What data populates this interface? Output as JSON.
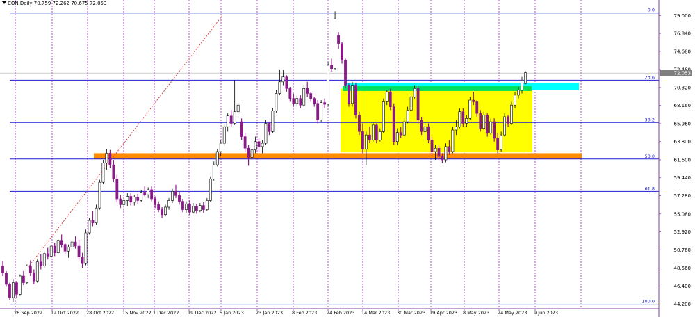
{
  "header": {
    "symbol_line": "CON,Daily  70.759 72.262 70.675 72.053"
  },
  "colors": {
    "bull": "#ffffff",
    "bear": "#8b1a89",
    "fib_line": "#1f1fd6",
    "orange_zone": "#ff8c00",
    "yellow_zone": "#ffff00",
    "cyan_zone": "#00ffff",
    "green_zone": "#00e060",
    "vgrid": "#a020c0",
    "trend": "#e03030",
    "axis": "#7b3fa0"
  },
  "chart_data": {
    "type": "candlestick",
    "title": "",
    "symbol": "CON",
    "timeframe": "Daily",
    "last_price": "72.053",
    "ylim": [
      44.0,
      80.2
    ],
    "y_ticks": [
      "79.000",
      "76.840",
      "74.680",
      "72.480",
      "70.320",
      "68.160",
      "65.960",
      "63.800",
      "61.600",
      "59.440",
      "57.280",
      "55.080",
      "52.920",
      "50.760",
      "48.560",
      "46.400",
      "44.200"
    ],
    "x_labels": [
      "26 Sep 2022",
      "12 Oct 2022",
      "28 Oct 2022",
      "15 Nov 2022",
      "1 Dec 2022",
      "19 Dec 2022",
      "5 Jan 2023",
      "23 Jan 2023",
      "8 Feb 2023",
      "24 Feb 2023",
      "14 Mar 2023",
      "30 Mar 2023",
      "19 Apr 2023",
      "8 May 2023",
      "24 May 2023",
      "9 Jun 2023"
    ],
    "fib_levels": [
      {
        "label": "0.0",
        "price": 79.3
      },
      {
        "label": "23.6",
        "price": 71.2
      },
      {
        "label": "38.2",
        "price": 66.1
      },
      {
        "label": "50.0",
        "price": 61.7
      },
      {
        "label": "61.8",
        "price": 57.8
      },
      {
        "label": "100.0",
        "price": 44.2
      }
    ],
    "candles": [
      {
        "o": 48.8,
        "h": 49.4,
        "l": 47.6,
        "c": 48.0
      },
      {
        "o": 48.0,
        "h": 48.2,
        "l": 46.3,
        "c": 46.6
      },
      {
        "o": 46.6,
        "h": 46.8,
        "l": 44.7,
        "c": 45.0
      },
      {
        "o": 45.0,
        "h": 47.2,
        "l": 44.5,
        "c": 46.8
      },
      {
        "o": 46.8,
        "h": 47.0,
        "l": 45.0,
        "c": 45.4
      },
      {
        "o": 45.4,
        "h": 47.8,
        "l": 45.2,
        "c": 47.6
      },
      {
        "o": 47.6,
        "h": 48.2,
        "l": 46.5,
        "c": 46.8
      },
      {
        "o": 46.8,
        "h": 49.0,
        "l": 46.6,
        "c": 48.8
      },
      {
        "o": 48.8,
        "h": 49.5,
        "l": 47.6,
        "c": 48.0
      },
      {
        "o": 48.0,
        "h": 48.4,
        "l": 46.6,
        "c": 47.0
      },
      {
        "o": 47.0,
        "h": 49.6,
        "l": 46.8,
        "c": 49.3
      },
      {
        "o": 49.3,
        "h": 50.2,
        "l": 48.4,
        "c": 48.8
      },
      {
        "o": 48.8,
        "h": 50.6,
        "l": 48.6,
        "c": 50.3
      },
      {
        "o": 50.3,
        "h": 51.0,
        "l": 49.6,
        "c": 50.0
      },
      {
        "o": 50.0,
        "h": 51.4,
        "l": 49.8,
        "c": 51.2
      },
      {
        "o": 51.2,
        "h": 51.6,
        "l": 50.0,
        "c": 50.4
      },
      {
        "o": 50.4,
        "h": 52.2,
        "l": 50.2,
        "c": 51.9
      },
      {
        "o": 51.9,
        "h": 52.6,
        "l": 51.0,
        "c": 51.4
      },
      {
        "o": 51.4,
        "h": 51.6,
        "l": 50.2,
        "c": 50.6
      },
      {
        "o": 50.6,
        "h": 51.4,
        "l": 49.8,
        "c": 51.1
      },
      {
        "o": 51.1,
        "h": 52.0,
        "l": 50.6,
        "c": 51.7
      },
      {
        "o": 51.7,
        "h": 52.4,
        "l": 50.9,
        "c": 51.2
      },
      {
        "o": 51.2,
        "h": 52.0,
        "l": 49.5,
        "c": 49.9
      },
      {
        "o": 49.9,
        "h": 50.4,
        "l": 48.6,
        "c": 49.1
      },
      {
        "o": 49.1,
        "h": 53.2,
        "l": 48.9,
        "c": 52.8
      },
      {
        "o": 52.8,
        "h": 54.6,
        "l": 52.6,
        "c": 54.3
      },
      {
        "o": 54.3,
        "h": 55.4,
        "l": 53.6,
        "c": 54.0
      },
      {
        "o": 54.0,
        "h": 56.2,
        "l": 53.8,
        "c": 55.8
      },
      {
        "o": 55.8,
        "h": 59.2,
        "l": 55.6,
        "c": 58.9
      },
      {
        "o": 58.9,
        "h": 61.6,
        "l": 58.7,
        "c": 61.2
      },
      {
        "o": 61.2,
        "h": 62.9,
        "l": 60.4,
        "c": 62.4
      },
      {
        "o": 62.4,
        "h": 62.8,
        "l": 60.6,
        "c": 61.0
      },
      {
        "o": 61.0,
        "h": 61.6,
        "l": 58.9,
        "c": 59.3
      },
      {
        "o": 59.3,
        "h": 59.8,
        "l": 56.5,
        "c": 56.9
      },
      {
        "o": 56.9,
        "h": 57.4,
        "l": 55.8,
        "c": 56.2
      },
      {
        "o": 56.2,
        "h": 57.0,
        "l": 55.4,
        "c": 56.7
      },
      {
        "o": 56.7,
        "h": 57.6,
        "l": 56.0,
        "c": 57.2
      },
      {
        "o": 57.2,
        "h": 57.6,
        "l": 56.1,
        "c": 56.5
      },
      {
        "o": 56.5,
        "h": 57.4,
        "l": 56.1,
        "c": 57.1
      },
      {
        "o": 57.1,
        "h": 57.5,
        "l": 56.3,
        "c": 56.7
      },
      {
        "o": 56.7,
        "h": 58.0,
        "l": 56.5,
        "c": 57.7
      },
      {
        "o": 57.7,
        "h": 58.4,
        "l": 57.2,
        "c": 57.4
      },
      {
        "o": 57.4,
        "h": 58.3,
        "l": 57.0,
        "c": 58.0
      },
      {
        "o": 58.0,
        "h": 58.4,
        "l": 56.6,
        "c": 56.9
      },
      {
        "o": 56.9,
        "h": 57.2,
        "l": 55.8,
        "c": 56.2
      },
      {
        "o": 56.2,
        "h": 56.6,
        "l": 55.3,
        "c": 55.6
      },
      {
        "o": 55.6,
        "h": 55.9,
        "l": 54.6,
        "c": 55.0
      },
      {
        "o": 55.0,
        "h": 56.2,
        "l": 54.8,
        "c": 55.9
      },
      {
        "o": 55.9,
        "h": 57.0,
        "l": 55.6,
        "c": 56.7
      },
      {
        "o": 56.7,
        "h": 58.1,
        "l": 56.4,
        "c": 57.8
      },
      {
        "o": 57.8,
        "h": 58.6,
        "l": 57.0,
        "c": 57.3
      },
      {
        "o": 57.3,
        "h": 57.8,
        "l": 56.2,
        "c": 56.6
      },
      {
        "o": 56.6,
        "h": 56.9,
        "l": 55.3,
        "c": 55.6
      },
      {
        "o": 55.6,
        "h": 56.6,
        "l": 55.2,
        "c": 56.3
      },
      {
        "o": 56.3,
        "h": 56.7,
        "l": 55.0,
        "c": 55.3
      },
      {
        "o": 55.3,
        "h": 56.4,
        "l": 55.1,
        "c": 56.0
      },
      {
        "o": 56.0,
        "h": 56.3,
        "l": 55.1,
        "c": 55.5
      },
      {
        "o": 55.5,
        "h": 56.4,
        "l": 55.3,
        "c": 56.1
      },
      {
        "o": 56.1,
        "h": 56.5,
        "l": 55.2,
        "c": 55.6
      },
      {
        "o": 55.6,
        "h": 57.0,
        "l": 55.4,
        "c": 56.7
      },
      {
        "o": 56.7,
        "h": 59.6,
        "l": 56.5,
        "c": 59.3
      },
      {
        "o": 59.3,
        "h": 61.4,
        "l": 59.1,
        "c": 61.0
      },
      {
        "o": 61.0,
        "h": 62.9,
        "l": 60.8,
        "c": 62.6
      },
      {
        "o": 62.6,
        "h": 64.0,
        "l": 62.0,
        "c": 63.6
      },
      {
        "o": 63.6,
        "h": 65.9,
        "l": 63.3,
        "c": 65.6
      },
      {
        "o": 65.6,
        "h": 67.2,
        "l": 65.0,
        "c": 66.9
      },
      {
        "o": 66.9,
        "h": 67.6,
        "l": 65.6,
        "c": 66.0
      },
      {
        "o": 66.0,
        "h": 71.2,
        "l": 65.8,
        "c": 67.4
      },
      {
        "o": 67.4,
        "h": 68.6,
        "l": 66.6,
        "c": 68.2
      },
      {
        "o": 66.2,
        "h": 66.6,
        "l": 64.0,
        "c": 64.4
      },
      {
        "o": 64.4,
        "h": 64.8,
        "l": 62.6,
        "c": 63.0
      },
      {
        "o": 63.0,
        "h": 63.4,
        "l": 60.9,
        "c": 61.9
      },
      {
        "o": 61.9,
        "h": 63.2,
        "l": 61.6,
        "c": 62.8
      },
      {
        "o": 62.8,
        "h": 64.4,
        "l": 62.4,
        "c": 63.8
      },
      {
        "o": 63.8,
        "h": 64.2,
        "l": 62.6,
        "c": 63.2
      },
      {
        "o": 63.2,
        "h": 64.0,
        "l": 62.4,
        "c": 63.6
      },
      {
        "o": 63.6,
        "h": 66.4,
        "l": 63.4,
        "c": 66.0
      },
      {
        "o": 66.0,
        "h": 66.2,
        "l": 64.6,
        "c": 65.0
      },
      {
        "o": 65.0,
        "h": 67.8,
        "l": 64.8,
        "c": 67.5
      },
      {
        "o": 67.5,
        "h": 70.0,
        "l": 67.3,
        "c": 69.6
      },
      {
        "o": 69.6,
        "h": 72.5,
        "l": 69.4,
        "c": 71.0
      },
      {
        "o": 71.0,
        "h": 72.4,
        "l": 70.6,
        "c": 71.6
      },
      {
        "o": 71.6,
        "h": 71.8,
        "l": 69.8,
        "c": 70.2
      },
      {
        "o": 70.2,
        "h": 70.4,
        "l": 68.6,
        "c": 69.0
      },
      {
        "o": 69.0,
        "h": 69.6,
        "l": 68.0,
        "c": 68.4
      },
      {
        "o": 68.4,
        "h": 69.4,
        "l": 68.0,
        "c": 69.0
      },
      {
        "o": 69.0,
        "h": 69.4,
        "l": 67.8,
        "c": 68.2
      },
      {
        "o": 68.2,
        "h": 70.6,
        "l": 68.0,
        "c": 70.2
      },
      {
        "o": 70.2,
        "h": 71.0,
        "l": 69.2,
        "c": 69.6
      },
      {
        "o": 69.6,
        "h": 69.8,
        "l": 68.6,
        "c": 69.0
      },
      {
        "o": 69.0,
        "h": 69.2,
        "l": 68.0,
        "c": 68.4
      },
      {
        "o": 68.4,
        "h": 68.8,
        "l": 66.0,
        "c": 66.4
      },
      {
        "o": 66.4,
        "h": 68.8,
        "l": 66.2,
        "c": 68.5
      },
      {
        "o": 68.5,
        "h": 69.0,
        "l": 67.8,
        "c": 68.3
      },
      {
        "o": 68.3,
        "h": 73.4,
        "l": 68.1,
        "c": 73.0
      },
      {
        "o": 73.0,
        "h": 73.8,
        "l": 72.2,
        "c": 72.6
      },
      {
        "o": 72.6,
        "h": 79.5,
        "l": 72.4,
        "c": 78.6
      },
      {
        "o": 76.6,
        "h": 77.0,
        "l": 75.0,
        "c": 75.6
      },
      {
        "o": 75.6,
        "h": 75.8,
        "l": 73.2,
        "c": 73.6
      },
      {
        "o": 73.6,
        "h": 73.8,
        "l": 70.2,
        "c": 70.6
      },
      {
        "o": 70.6,
        "h": 70.8,
        "l": 68.0,
        "c": 68.4
      },
      {
        "o": 68.4,
        "h": 71.0,
        "l": 68.0,
        "c": 70.6
      },
      {
        "o": 70.6,
        "h": 70.9,
        "l": 66.6,
        "c": 67.0
      },
      {
        "o": 67.0,
        "h": 67.4,
        "l": 64.6,
        "c": 65.0
      },
      {
        "o": 65.0,
        "h": 66.0,
        "l": 62.4,
        "c": 62.9
      },
      {
        "o": 62.9,
        "h": 65.0,
        "l": 61.0,
        "c": 64.6
      },
      {
        "o": 64.6,
        "h": 65.6,
        "l": 63.6,
        "c": 64.0
      },
      {
        "o": 64.0,
        "h": 66.2,
        "l": 63.8,
        "c": 65.8
      },
      {
        "o": 65.8,
        "h": 66.0,
        "l": 63.6,
        "c": 64.0
      },
      {
        "o": 64.0,
        "h": 65.4,
        "l": 63.8,
        "c": 65.0
      },
      {
        "o": 65.0,
        "h": 69.0,
        "l": 64.8,
        "c": 68.6
      },
      {
        "o": 68.6,
        "h": 70.0,
        "l": 68.2,
        "c": 69.8
      },
      {
        "o": 69.8,
        "h": 70.2,
        "l": 67.6,
        "c": 68.0
      },
      {
        "o": 68.0,
        "h": 68.4,
        "l": 63.4,
        "c": 63.8
      },
      {
        "o": 63.8,
        "h": 65.4,
        "l": 63.4,
        "c": 64.9
      },
      {
        "o": 64.9,
        "h": 65.6,
        "l": 64.2,
        "c": 64.6
      },
      {
        "o": 64.6,
        "h": 66.6,
        "l": 64.4,
        "c": 66.2
      },
      {
        "o": 66.2,
        "h": 68.0,
        "l": 66.0,
        "c": 67.6
      },
      {
        "o": 67.6,
        "h": 69.6,
        "l": 67.4,
        "c": 69.2
      },
      {
        "o": 69.2,
        "h": 70.6,
        "l": 69.0,
        "c": 70.2
      },
      {
        "o": 70.2,
        "h": 70.6,
        "l": 66.0,
        "c": 66.4
      },
      {
        "o": 66.4,
        "h": 66.8,
        "l": 64.6,
        "c": 65.0
      },
      {
        "o": 65.0,
        "h": 66.0,
        "l": 64.0,
        "c": 65.6
      },
      {
        "o": 65.6,
        "h": 66.0,
        "l": 63.6,
        "c": 64.0
      },
      {
        "o": 64.0,
        "h": 64.4,
        "l": 62.2,
        "c": 62.6
      },
      {
        "o": 62.6,
        "h": 63.4,
        "l": 61.6,
        "c": 63.0
      },
      {
        "o": 63.0,
        "h": 63.4,
        "l": 61.6,
        "c": 62.0
      },
      {
        "o": 62.0,
        "h": 62.4,
        "l": 61.2,
        "c": 61.6
      },
      {
        "o": 61.6,
        "h": 63.6,
        "l": 61.3,
        "c": 63.2
      },
      {
        "o": 63.2,
        "h": 64.0,
        "l": 62.2,
        "c": 62.6
      },
      {
        "o": 62.6,
        "h": 65.6,
        "l": 62.4,
        "c": 65.2
      },
      {
        "o": 65.2,
        "h": 66.4,
        "l": 64.6,
        "c": 65.6
      },
      {
        "o": 65.6,
        "h": 67.8,
        "l": 65.4,
        "c": 67.4
      },
      {
        "o": 67.4,
        "h": 67.8,
        "l": 65.6,
        "c": 66.0
      },
      {
        "o": 66.0,
        "h": 67.0,
        "l": 65.6,
        "c": 66.6
      },
      {
        "o": 66.6,
        "h": 69.2,
        "l": 66.4,
        "c": 68.8
      },
      {
        "o": 68.8,
        "h": 69.8,
        "l": 68.2,
        "c": 68.6
      },
      {
        "o": 68.6,
        "h": 68.8,
        "l": 66.8,
        "c": 67.2
      },
      {
        "o": 67.2,
        "h": 67.6,
        "l": 65.0,
        "c": 65.4
      },
      {
        "o": 65.4,
        "h": 67.4,
        "l": 65.2,
        "c": 67.0
      },
      {
        "o": 67.0,
        "h": 67.2,
        "l": 64.4,
        "c": 64.8
      },
      {
        "o": 64.8,
        "h": 66.6,
        "l": 64.6,
        "c": 66.2
      },
      {
        "o": 66.2,
        "h": 66.6,
        "l": 63.8,
        "c": 64.2
      },
      {
        "o": 64.2,
        "h": 64.8,
        "l": 62.4,
        "c": 62.8
      },
      {
        "o": 62.8,
        "h": 65.0,
        "l": 62.6,
        "c": 64.6
      },
      {
        "o": 64.6,
        "h": 67.2,
        "l": 64.4,
        "c": 66.8
      },
      {
        "o": 66.8,
        "h": 67.0,
        "l": 65.6,
        "c": 66.0
      },
      {
        "o": 66.0,
        "h": 68.6,
        "l": 65.8,
        "c": 68.2
      },
      {
        "o": 68.2,
        "h": 69.8,
        "l": 67.8,
        "c": 69.4
      },
      {
        "o": 69.4,
        "h": 70.4,
        "l": 69.0,
        "c": 70.0
      },
      {
        "o": 70.0,
        "h": 71.6,
        "l": 69.6,
        "c": 71.2
      },
      {
        "o": 70.8,
        "h": 72.3,
        "l": 70.7,
        "c": 72.1
      }
    ]
  }
}
